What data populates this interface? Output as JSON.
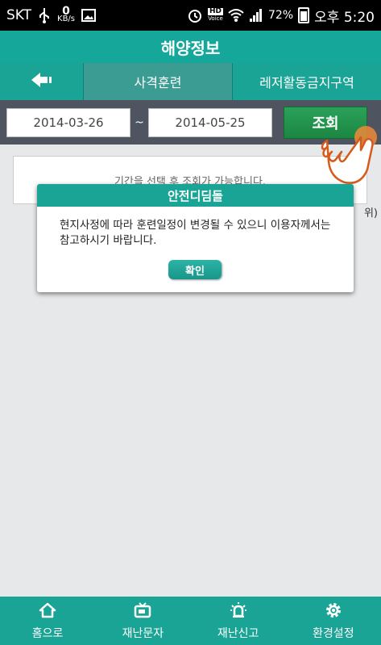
{
  "status_bar": {
    "carrier": "SKT",
    "net_speed_value": "0",
    "net_speed_unit": "KB/s",
    "hd_voice": "HD Voice",
    "battery": "72%",
    "time": "오후 5:20"
  },
  "header": {
    "title": "해양정보"
  },
  "tabs": [
    {
      "label": "사격훈련",
      "active": true
    },
    {
      "label": "레저활동금지구역",
      "active": false
    }
  ],
  "search": {
    "start_date": "2014-03-26",
    "separator": "~",
    "end_date": "2014-05-25",
    "button_label": "조회"
  },
  "content": {
    "info_text": "기간을 선택 후 조회가 가능합니다.",
    "partial_text": "위)"
  },
  "dialog": {
    "title": "안전디딤돌",
    "message": "현지사정에 따라 훈련일정이 변경될 수 있으니 이용자께서는 참고하시기 바랍니다.",
    "ok_label": "확인"
  },
  "bottom_nav": [
    {
      "label": "홈으로",
      "icon": "home-icon"
    },
    {
      "label": "재난문자",
      "icon": "tv-icon"
    },
    {
      "label": "재난신고",
      "icon": "siren-icon"
    },
    {
      "label": "환경설정",
      "icon": "gear-icon"
    }
  ],
  "colors": {
    "primary": "#1aa495",
    "search_bar": "#4e5460",
    "search_button": "#1b8642"
  }
}
